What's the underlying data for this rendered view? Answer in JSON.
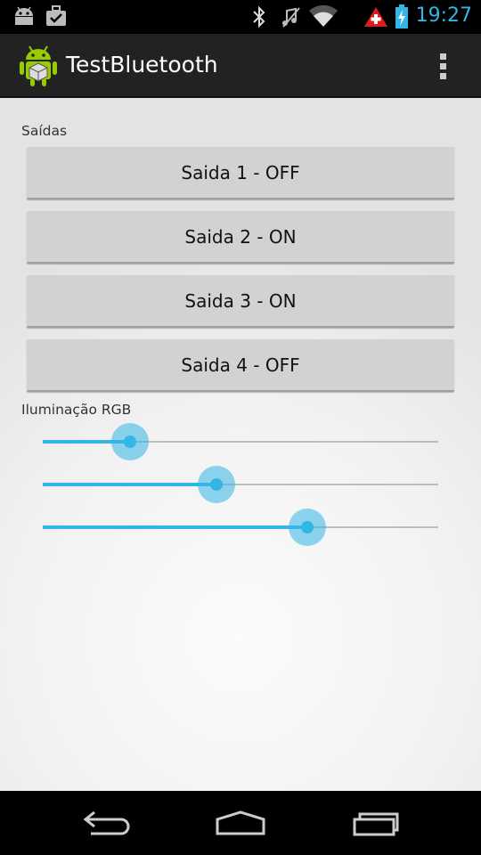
{
  "status_bar": {
    "time": "19:27",
    "left_icons": [
      "android-debug-icon",
      "briefcase-check-icon"
    ],
    "right_icons": [
      "bluetooth-icon",
      "mute-icon",
      "wifi-icon",
      "warning-plus-icon",
      "battery-charging-icon"
    ],
    "time_color": "#33b5e5"
  },
  "action_bar": {
    "title": "TestBluetooth",
    "app_icon": "android-app-icon",
    "overflow_icon": "overflow-menu-icon"
  },
  "outputs": {
    "label": "Saídas",
    "buttons": [
      {
        "label": "Saida 1 - OFF"
      },
      {
        "label": "Saida 2 - ON"
      },
      {
        "label": "Saida 3 - ON"
      },
      {
        "label": "Saida 4 - OFF"
      }
    ]
  },
  "rgb": {
    "label": "Iluminação RGB",
    "sliders": [
      {
        "name": "slider-red",
        "value": 0.22
      },
      {
        "name": "slider-green",
        "value": 0.44
      },
      {
        "name": "slider-blue",
        "value": 0.67
      }
    ],
    "accent": "#33b5e5"
  },
  "nav_bar": {
    "icons": [
      "back-icon",
      "home-icon",
      "recents-icon"
    ]
  }
}
